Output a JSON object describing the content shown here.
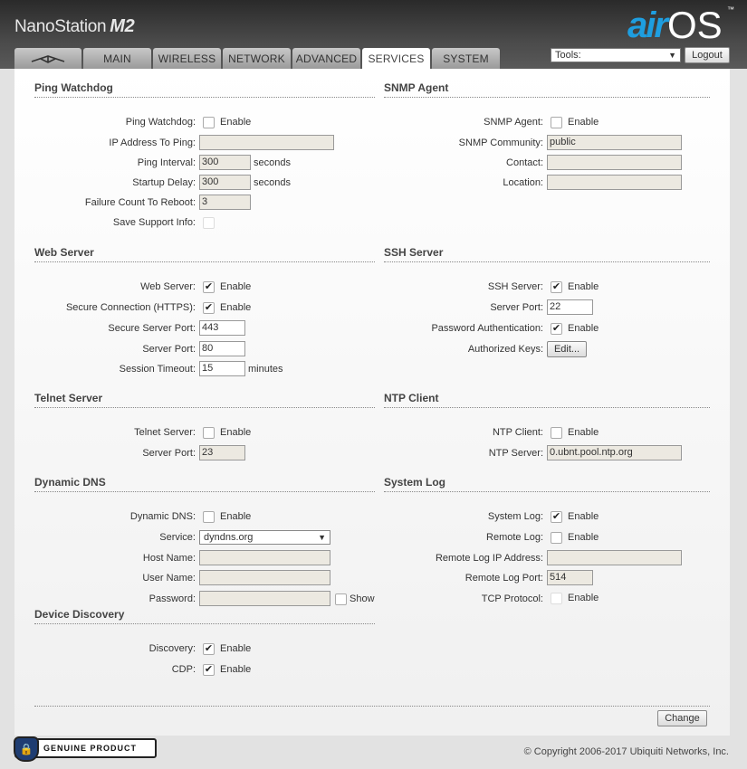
{
  "header": {
    "product_name": "NanoStation",
    "product_model": "M2",
    "brand_air": "air",
    "brand_os": "OS",
    "brand_tm": "™"
  },
  "tabs": [
    {
      "label": "MAIN"
    },
    {
      "label": "WIRELESS"
    },
    {
      "label": "NETWORK"
    },
    {
      "label": "ADVANCED"
    },
    {
      "label": "SERVICES",
      "active": true
    },
    {
      "label": "SYSTEM"
    }
  ],
  "tools": {
    "selected": "Tools:",
    "logout_label": "Logout"
  },
  "ping": {
    "title": "Ping Watchdog",
    "watchdog_label": "Ping Watchdog:",
    "enable": "Enable",
    "ip_label": "IP Address To Ping:",
    "ip_value": "",
    "interval_label": "Ping Interval:",
    "interval_value": "300",
    "seconds": "seconds",
    "startup_label": "Startup Delay:",
    "startup_value": "300",
    "failure_label": "Failure Count To Reboot:",
    "failure_value": "3",
    "support_label": "Save Support Info:"
  },
  "snmp": {
    "title": "SNMP Agent",
    "agent_label": "SNMP Agent:",
    "enable": "Enable",
    "community_label": "SNMP Community:",
    "community_value": "public",
    "contact_label": "Contact:",
    "contact_value": "",
    "location_label": "Location:",
    "location_value": ""
  },
  "web": {
    "title": "Web Server",
    "server_label": "Web Server:",
    "enable": "Enable",
    "https_label": "Secure Connection (HTTPS):",
    "secure_port_label": "Secure Server Port:",
    "secure_port_value": "443",
    "port_label": "Server Port:",
    "port_value": "80",
    "timeout_label": "Session Timeout:",
    "timeout_value": "15",
    "minutes": "minutes"
  },
  "ssh": {
    "title": "SSH Server",
    "server_label": "SSH Server:",
    "enable": "Enable",
    "port_label": "Server Port:",
    "port_value": "22",
    "password_label": "Password Authentication:",
    "keys_label": "Authorized Keys:",
    "edit_label": "Edit..."
  },
  "telnet": {
    "title": "Telnet Server",
    "server_label": "Telnet Server:",
    "enable": "Enable",
    "port_label": "Server Port:",
    "port_value": "23"
  },
  "ntp": {
    "title": "NTP Client",
    "client_label": "NTP Client:",
    "enable": "Enable",
    "server_label": "NTP Server:",
    "server_value": "0.ubnt.pool.ntp.org"
  },
  "ddns": {
    "title": "Dynamic DNS",
    "ddns_label": "Dynamic DNS:",
    "enable": "Enable",
    "service_label": "Service:",
    "service_value": "dyndns.org",
    "host_label": "Host Name:",
    "user_label": "User Name:",
    "password_label": "Password:",
    "show": "Show"
  },
  "syslog": {
    "title": "System Log",
    "log_label": "System Log:",
    "enable": "Enable",
    "remote_label": "Remote Log:",
    "remote_ip_label": "Remote Log IP Address:",
    "remote_port_label": "Remote Log Port:",
    "remote_port_value": "514",
    "tcp_label": "TCP Protocol:"
  },
  "discovery": {
    "title": "Device Discovery",
    "discovery_label": "Discovery:",
    "enable": "Enable",
    "cdp_label": "CDP:"
  },
  "footer": {
    "change_label": "Change",
    "badge_text": "GENUINE PRODUCT",
    "copyright": "© Copyright 2006-2017 Ubiquiti Networks, Inc."
  }
}
